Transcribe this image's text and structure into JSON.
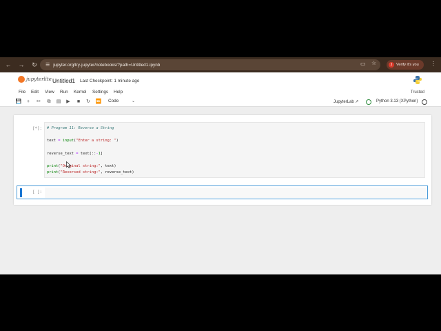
{
  "browser": {
    "url": "jupyter.org/try-jupyter/notebooks/?path=Untitled1.ipynb",
    "profile_label": "Verify it's you"
  },
  "header": {
    "logo_text": "jupyterlite",
    "notebook_title": "Untitled1",
    "checkpoint": "Last Checkpoint: 1 minute ago"
  },
  "menu": {
    "items": [
      "File",
      "Edit",
      "View",
      "Run",
      "Kernel",
      "Settings",
      "Help"
    ],
    "trusted": "Trusted"
  },
  "toolbar": {
    "cell_type": "Code",
    "jupyterlab_link": "JupyterLab",
    "kernel": "Python 3.13 (XPython)"
  },
  "cells": [
    {
      "prompt": "[*]:",
      "lines": [
        "# Program 11: Reverse a String",
        "",
        "text = input(\"Enter a string: \")",
        "",
        "reverse_text = text[::-1]",
        "",
        "print(\"Original string:\", text)",
        "print(\"Reversed string:\", reverse_text)"
      ]
    },
    {
      "prompt": "[ ]:"
    }
  ],
  "colors": {
    "chrome": "#3c2c20",
    "accent_orange": "#f37726",
    "active_cell": "#1976d2"
  }
}
